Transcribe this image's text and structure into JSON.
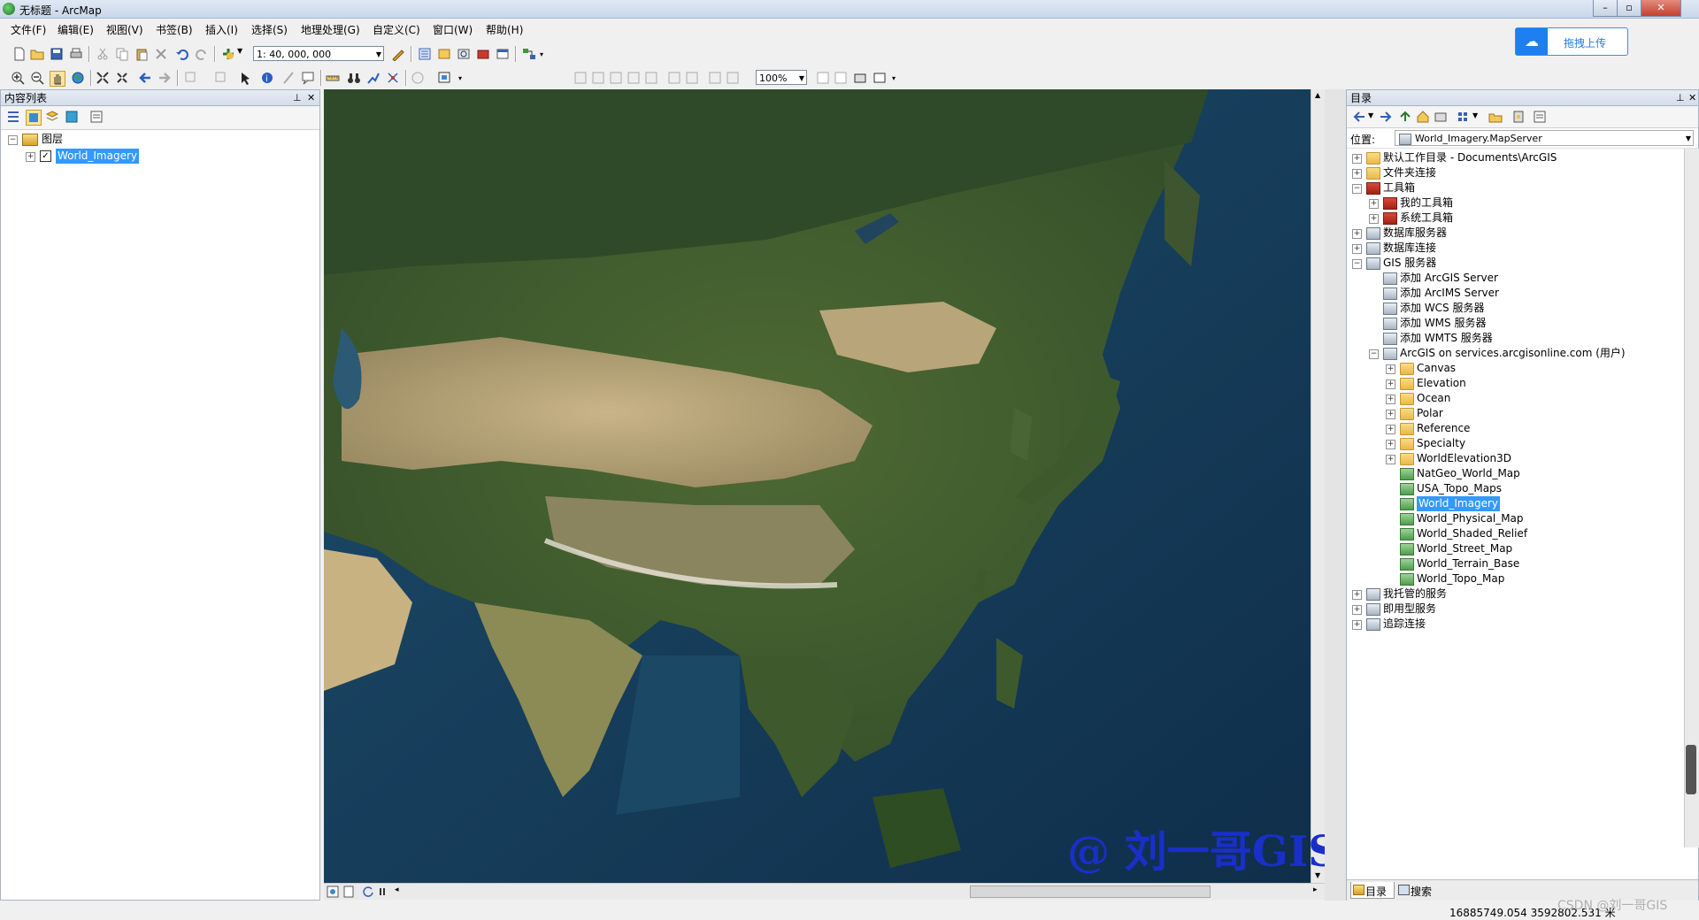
{
  "window": {
    "title": "无标题 - ArcMap"
  },
  "menu": [
    "文件(F)",
    "编辑(E)",
    "视图(V)",
    "书签(B)",
    "插入(I)",
    "选择(S)",
    "地理处理(G)",
    "自定义(C)",
    "窗口(W)",
    "帮助(H)"
  ],
  "toolbar": {
    "scale_value": "1: 40, 000, 000",
    "zoom_value": "100%"
  },
  "upload_button": {
    "label": "拖拽上传",
    "accent": "#1e7ff0"
  },
  "toc": {
    "title": "内容列表",
    "group_label": "图层",
    "layer_label": "World_Imagery",
    "layer_checked": true
  },
  "catalog": {
    "title": "目录",
    "location_label": "位置:",
    "location_value": "World_Imagery.MapServer",
    "items": [
      {
        "label": "默认工作目录 - Documents\\ArcGIS",
        "level": 0,
        "expander": "+",
        "icon": "folder-home-icon"
      },
      {
        "label": "文件夹连接",
        "level": 0,
        "expander": "+",
        "icon": "folder-connection-icon"
      },
      {
        "label": "工具箱",
        "level": 0,
        "expander": "-",
        "icon": "toolbox-icon"
      },
      {
        "label": "我的工具箱",
        "level": 1,
        "expander": "+",
        "icon": "toolbox-icon"
      },
      {
        "label": "系统工具箱",
        "level": 1,
        "expander": "+",
        "icon": "toolbox-icon"
      },
      {
        "label": "数据库服务器",
        "level": 0,
        "expander": "+",
        "icon": "database-server-icon"
      },
      {
        "label": "数据库连接",
        "level": 0,
        "expander": "+",
        "icon": "database-connection-icon"
      },
      {
        "label": "GIS 服务器",
        "level": 0,
        "expander": "-",
        "icon": "gis-server-icon"
      },
      {
        "label": "添加 ArcGIS Server",
        "level": 1,
        "expander": "",
        "icon": "add-server-icon"
      },
      {
        "label": "添加 ArcIMS Server",
        "level": 1,
        "expander": "",
        "icon": "add-server-icon"
      },
      {
        "label": "添加 WCS 服务器",
        "level": 1,
        "expander": "",
        "icon": "add-server-icon"
      },
      {
        "label": "添加 WMS 服务器",
        "level": 1,
        "expander": "",
        "icon": "add-server-icon"
      },
      {
        "label": "添加 WMTS 服务器",
        "level": 1,
        "expander": "",
        "icon": "add-server-icon"
      },
      {
        "label": "ArcGIS on services.arcgisonline.com (用户)",
        "level": 1,
        "expander": "-",
        "icon": "server-connection-icon"
      },
      {
        "label": "Canvas",
        "level": 2,
        "expander": "+",
        "icon": "folder-icon"
      },
      {
        "label": "Elevation",
        "level": 2,
        "expander": "+",
        "icon": "folder-icon"
      },
      {
        "label": "Ocean",
        "level": 2,
        "expander": "+",
        "icon": "folder-icon"
      },
      {
        "label": "Polar",
        "level": 2,
        "expander": "+",
        "icon": "folder-icon"
      },
      {
        "label": "Reference",
        "level": 2,
        "expander": "+",
        "icon": "folder-icon"
      },
      {
        "label": "Specialty",
        "level": 2,
        "expander": "+",
        "icon": "folder-icon"
      },
      {
        "label": "WorldElevation3D",
        "level": 2,
        "expander": "+",
        "icon": "folder-icon"
      },
      {
        "label": "NatGeo_World_Map",
        "level": 2,
        "expander": "",
        "icon": "map-service-icon"
      },
      {
        "label": "USA_Topo_Maps",
        "level": 2,
        "expander": "",
        "icon": "map-service-icon"
      },
      {
        "label": "World_Imagery",
        "level": 2,
        "expander": "",
        "icon": "map-service-icon",
        "selected": true
      },
      {
        "label": "World_Physical_Map",
        "level": 2,
        "expander": "",
        "icon": "map-service-icon"
      },
      {
        "label": "World_Shaded_Relief",
        "level": 2,
        "expander": "",
        "icon": "map-service-icon"
      },
      {
        "label": "World_Street_Map",
        "level": 2,
        "expander": "",
        "icon": "map-service-icon"
      },
      {
        "label": "World_Terrain_Base",
        "level": 2,
        "expander": "",
        "icon": "map-service-icon"
      },
      {
        "label": "World_Topo_Map",
        "level": 2,
        "expander": "",
        "icon": "map-service-icon"
      },
      {
        "label": "我托管的服务",
        "level": 0,
        "expander": "+",
        "icon": "hosted-services-icon"
      },
      {
        "label": "即用型服务",
        "level": 0,
        "expander": "+",
        "icon": "ready-services-icon"
      },
      {
        "label": "追踪连接",
        "level": 0,
        "expander": "+",
        "icon": "tracking-connection-icon"
      }
    ],
    "tabs": [
      "目录",
      "搜索"
    ]
  },
  "watermark": {
    "text": "@ 刘一哥GIS",
    "color": "#1a2fc8"
  },
  "status": {
    "coordinates": "16885749.054  3592802.531 米",
    "credit": "CSDN @刘一哥GIS"
  }
}
